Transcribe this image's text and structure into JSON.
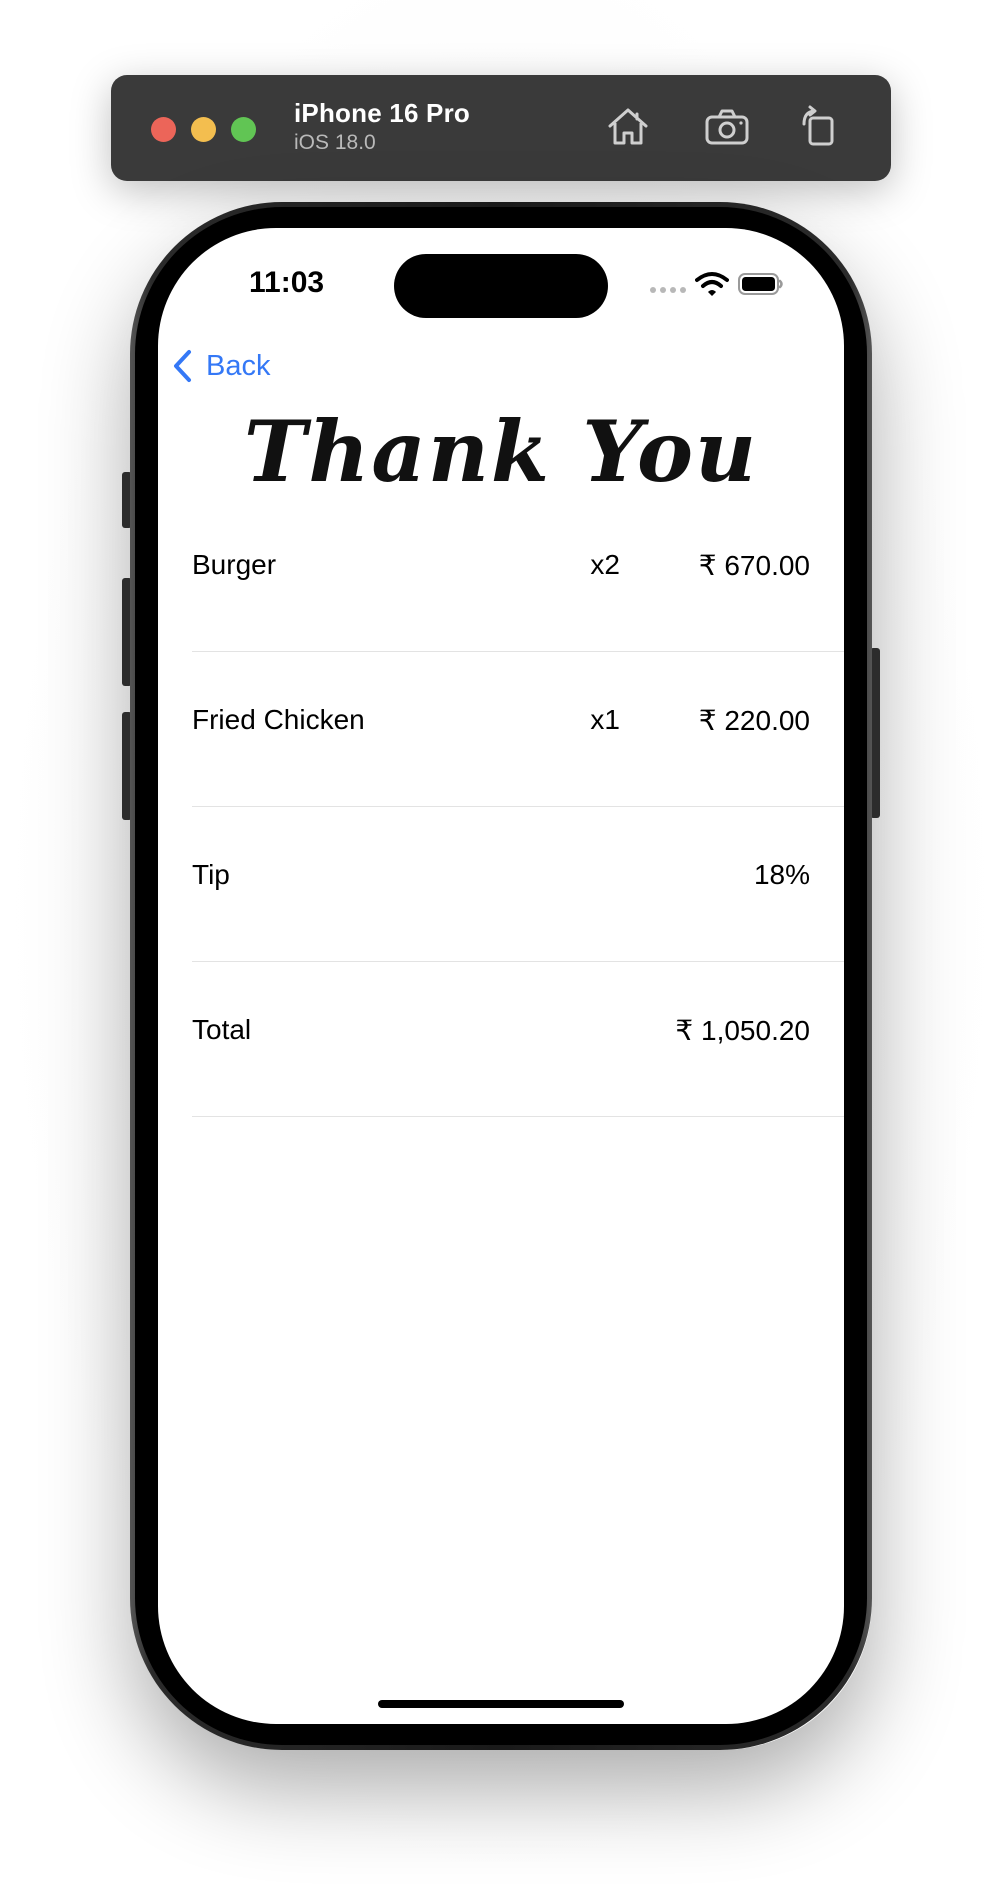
{
  "simulator": {
    "device_name": "iPhone 16 Pro",
    "os_version": "iOS 18.0",
    "icons": [
      "home-icon",
      "screenshot-icon",
      "rotate-icon"
    ]
  },
  "status_bar": {
    "time": "11:03"
  },
  "nav": {
    "back_label": "Back"
  },
  "page": {
    "heading": "Thank You"
  },
  "rows": [
    {
      "label": "Burger",
      "qty": "x2",
      "value": "₹ 670.00"
    },
    {
      "label": "Fried Chicken",
      "qty": "x1",
      "value": "₹ 220.00"
    },
    {
      "label": "Tip",
      "qty": "",
      "value": "18%"
    },
    {
      "label": "Total",
      "qty": "",
      "value": "₹ 1,050.20"
    }
  ],
  "colors": {
    "accent": "#3478f6",
    "sim_bar": "#3a3a3a",
    "traffic_red": "#ec6559",
    "traffic_yellow": "#f3be4f",
    "traffic_green": "#61c554"
  }
}
